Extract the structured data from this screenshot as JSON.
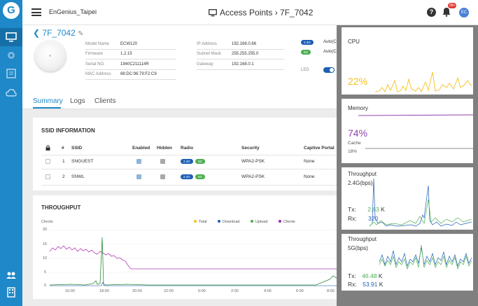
{
  "header": {
    "org": "EnGenius_Taipei",
    "title": "Access Points › 7F_7042",
    "notif_badge": "99+",
    "avatar": "EC"
  },
  "rail": {
    "logo": "G",
    "items": [
      "monitor-icon",
      "gear-icon",
      "list-icon",
      "cloud-icon"
    ],
    "bottom_items": [
      "users-icon",
      "building-icon"
    ],
    "accent": "#1e88c8"
  },
  "device": {
    "name": "7F_7042",
    "info1": [
      {
        "k": "Model Name",
        "v": "ECW120"
      },
      {
        "k": "Firmware",
        "v": "1.2.15"
      },
      {
        "k": "Serial NO.",
        "v": "1940C211114R"
      },
      {
        "k": "MAC Address",
        "v": "88:DC:96:79:F2:C9"
      }
    ],
    "info2": [
      {
        "k": "IP Address",
        "v": "192.168.0.66"
      },
      {
        "k": "Subnet Mask",
        "v": "255.255.255.0"
      },
      {
        "k": "Gateway",
        "v": "192.168.0.1"
      }
    ],
    "band_24": "2.4G",
    "band_5": "5G",
    "auto1": "Auto(C",
    "auto2": "Auto(C",
    "led": "LED"
  },
  "tabs": [
    "Summary",
    "Logs",
    "Clients"
  ],
  "ssid": {
    "title": "SSID INFORMATION",
    "headers": {
      "num": "#",
      "ssid": "SSID",
      "enabled": "Enabled",
      "hidden": "Hidden",
      "radio": "Radio",
      "security": "Security",
      "captive": "Captive Portal"
    },
    "rows": [
      {
        "num": "1",
        "ssid": "SNGUEST",
        "radio24": "2.4G",
        "radio5": "5G",
        "security": "WPA2-PSK",
        "captive": "None"
      },
      {
        "num": "2",
        "ssid": "SNWL",
        "radio24": "2.4G",
        "radio5": "5G",
        "security": "WPA2-PSK",
        "captive": "None"
      }
    ]
  },
  "throughput": {
    "title": "THROUGHPUT",
    "axis_label": "Clients",
    "legend": [
      {
        "name": "Total",
        "color": "#f5c021"
      },
      {
        "name": "Download",
        "color": "#1e5fb4"
      },
      {
        "name": "Upload",
        "color": "#4caf50"
      },
      {
        "name": "Clients",
        "color": "#9c27b0"
      }
    ],
    "y_ticks": [
      "20",
      "15",
      "10",
      "5",
      "0"
    ],
    "x_ticks": [
      "16:00",
      "18:00",
      "20:00",
      "22:00",
      "0:00",
      "2:00",
      "4:00",
      "6:00",
      "8:00"
    ]
  },
  "chart_data": {
    "type": "line",
    "x": [
      "16:00",
      "18:00",
      "20:00",
      "22:00",
      "0:00",
      "2:00",
      "4:00",
      "6:00",
      "8:00"
    ],
    "ylim": [
      0,
      20
    ],
    "series": [
      {
        "name": "Clients",
        "values": [
          14,
          13,
          11,
          6,
          6,
          6,
          6,
          6,
          7
        ]
      },
      {
        "name": "Upload",
        "values": [
          1,
          15,
          0,
          0,
          0,
          0,
          0,
          0,
          3
        ]
      },
      {
        "name": "Download",
        "values": [
          0,
          1,
          0,
          0,
          0,
          0,
          0,
          0,
          1
        ]
      }
    ]
  },
  "panel": {
    "cpu": {
      "label": "CPU",
      "value": "22%",
      "color": "#f5c021"
    },
    "memory": {
      "label": "Memory",
      "value": "74%",
      "cache_label": "Cache",
      "cache_value": "18%",
      "color": "#8e44ad"
    },
    "tp24": {
      "label": "Throughput",
      "sub": "2.4G(bps)",
      "tx_label": "Tx:",
      "tx": "2.63",
      "tx_unit": "K",
      "rx_label": "Rx:",
      "rx": "320"
    },
    "tp5": {
      "label": "Throughput",
      "sub": "5G(bps)",
      "tx_label": "Tx:",
      "tx": "46.48",
      "tx_unit": "K",
      "rx_label": "Rx:",
      "rx": "53.91",
      "rx_unit": "K"
    }
  }
}
